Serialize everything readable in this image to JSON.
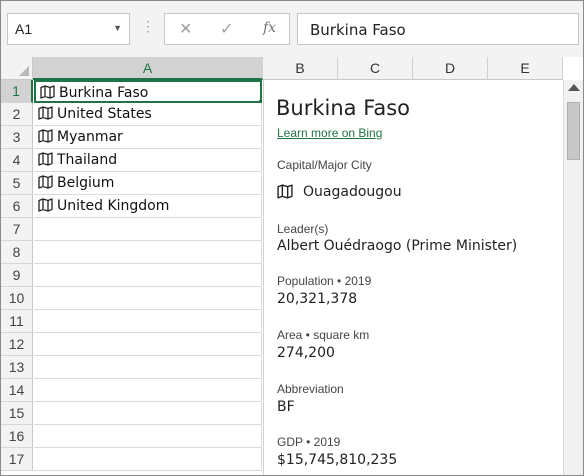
{
  "formula_bar": {
    "name_box": "A1",
    "formula_value": "Burkina Faso",
    "fx_label": "fx"
  },
  "columns": [
    "A",
    "B",
    "C",
    "D",
    "E"
  ],
  "rows": [
    "1",
    "2",
    "3",
    "4",
    "5",
    "6",
    "7",
    "8",
    "9",
    "10",
    "11",
    "12",
    "13",
    "14",
    "15",
    "16",
    "17"
  ],
  "cells": [
    "Burkina Faso",
    "United States",
    "Myanmar",
    "Thailand",
    "Belgium",
    "United Kingdom"
  ],
  "card": {
    "title": "Burkina Faso",
    "link": "Learn more on Bing",
    "capital_label": "Capital/Major City",
    "capital_value": "Ouagadougou",
    "leader_label": "Leader(s)",
    "leader_value": "Albert Ouédraogo (Prime Minister)",
    "population_label": "Population • 2019",
    "population_value": "20,321,378",
    "area_label": "Area • square km",
    "area_value": "274,200",
    "abbr_label": "Abbreviation",
    "abbr_value": "BF",
    "gdp_label": "GDP • 2019",
    "gdp_value": "$15,745,810,235"
  },
  "colors": {
    "accent": "#217346",
    "header_bg": "#f3f3f3"
  },
  "icons": [
    "map-icon",
    "cancel-icon",
    "enter-icon",
    "function-icon",
    "dropdown-icon"
  ]
}
